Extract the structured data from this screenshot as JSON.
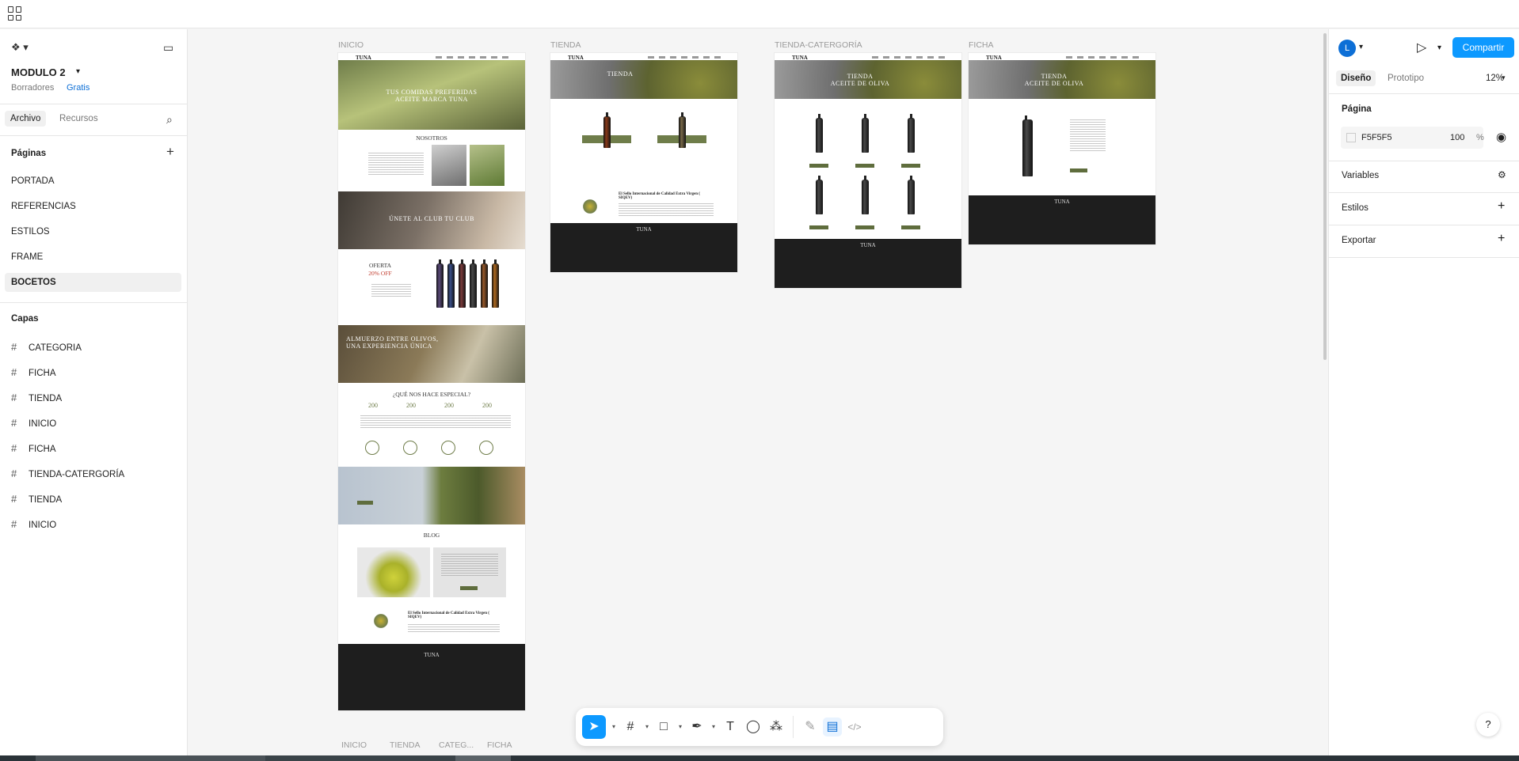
{
  "file": {
    "name": "MODULO 2",
    "project": "Borradores",
    "plan": "Gratis"
  },
  "left_tabs": {
    "file": "Archivo",
    "assets": "Recursos"
  },
  "pages": {
    "header": "Páginas",
    "items": [
      "PORTADA",
      "REFERENCIAS",
      "ESTILOS",
      "FRAME",
      "BOCETOS"
    ],
    "selected": "BOCETOS"
  },
  "layers": {
    "header": "Capas",
    "items": [
      "CATEGORIA",
      "FICHA",
      "TIENDA",
      "INICIO",
      "FICHA",
      "TIENDA-CATERGORÍA",
      "TIENDA",
      "INICIO"
    ]
  },
  "right": {
    "avatar": "L",
    "share": "Compartir",
    "tabs": {
      "design": "Diseño",
      "prototype": "Prototipo"
    },
    "zoom": "12%",
    "page_section": "Página",
    "bg_color": "F5F5F5",
    "opacity": "100",
    "opacity_unit": "%",
    "variables": "Variables",
    "styles": "Estilos",
    "export": "Exportar"
  },
  "canvas": {
    "frame_labels": [
      "INICIO",
      "TIENDA",
      "TIENDA-CATERGORÍA",
      "FICHA"
    ],
    "bottom_labels": [
      "INICIO",
      "TIENDA",
      "CATEG...",
      "FICHA"
    ]
  },
  "inicio": {
    "brand": "TUNA",
    "hero": "TUS COMIDAS PREFERIDAS\nACEITE MARCA TUNA",
    "nosotros": "NOSOTROS",
    "club": "ÚNETE AL CLUB  TU CLUB",
    "oferta": "OFERTA",
    "oferta_pct": "20% OFF",
    "almuerzo": "ALMUERZO ENTRE OLIVOS,\nUNA EXPERIENCIA ÚNICA",
    "especial": "¿QUÉ NOS HACE ESPECIAL?",
    "stats": [
      "200",
      "200",
      "200",
      "200"
    ],
    "blog": "BLOG",
    "sello": "El Sello Internacional de Calidad Extra Virgen ( SIQEV)",
    "footer_brand": "TUNA"
  },
  "tienda": {
    "brand": "TUNA",
    "hero": "TIENDA",
    "sello": "El Sello Internacional de Calidad Extra Virgen ( SIQEV)",
    "footer_brand": "TUNA"
  },
  "tienda_cat": {
    "brand": "TUNA",
    "hero": "TIENDA\nACEITE DE OLIVA",
    "footer_brand": "TUNA"
  },
  "ficha": {
    "brand": "TUNA",
    "hero": "TIENDA\nACEITE DE OLIVA",
    "footer_brand": "TUNA"
  }
}
